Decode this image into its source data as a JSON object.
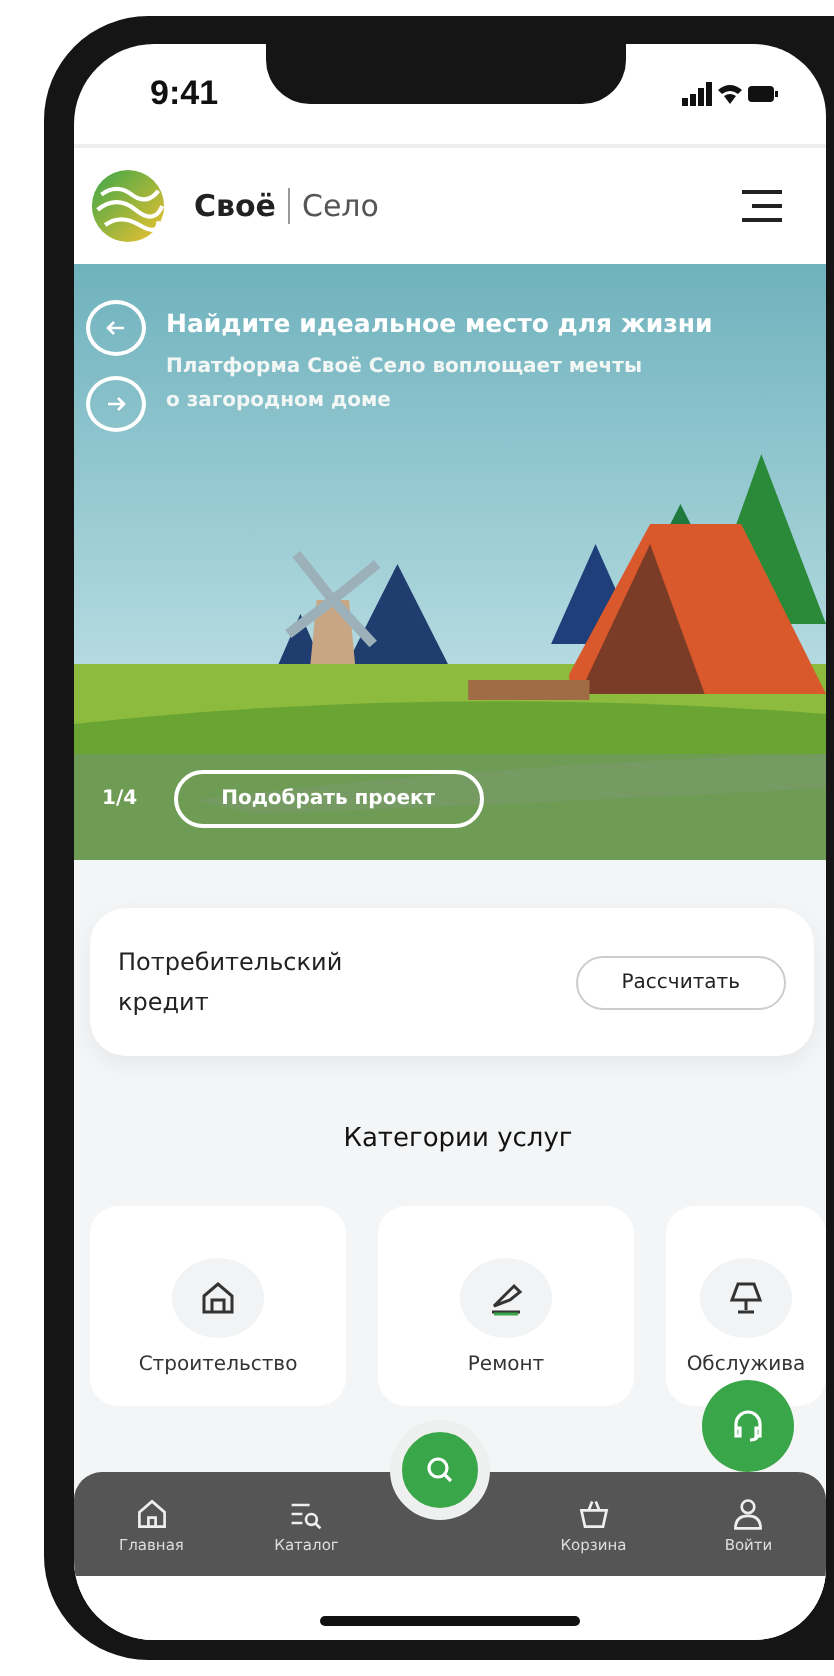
{
  "status_bar": {
    "time": "9:41"
  },
  "header": {
    "brand": "Своё",
    "brand_sub": "Село"
  },
  "hero": {
    "title": "Найдите идеальное место для жизни",
    "subtitle": "Платформа Своё Село воплощает мечты о загородном доме",
    "counter": "1/4",
    "button": "Подобрать проект",
    "kind": "picture"
  },
  "credit_card": {
    "title": "Потребительский кредит",
    "button": "Рассчитать"
  },
  "categories": {
    "title": "Категории услуг",
    "items": [
      {
        "label": "Строительство",
        "kind": "house"
      },
      {
        "label": "Ремонт",
        "kind": "tool"
      },
      {
        "label": "Обслужива",
        "kind": "lamp"
      }
    ]
  },
  "bottom_nav": [
    {
      "label": "Главная",
      "kind": "home"
    },
    {
      "label": "Каталог",
      "kind": "catalog"
    },
    {
      "label": "Корзина",
      "kind": "basket"
    },
    {
      "label": "Войти",
      "kind": "user"
    }
  ]
}
